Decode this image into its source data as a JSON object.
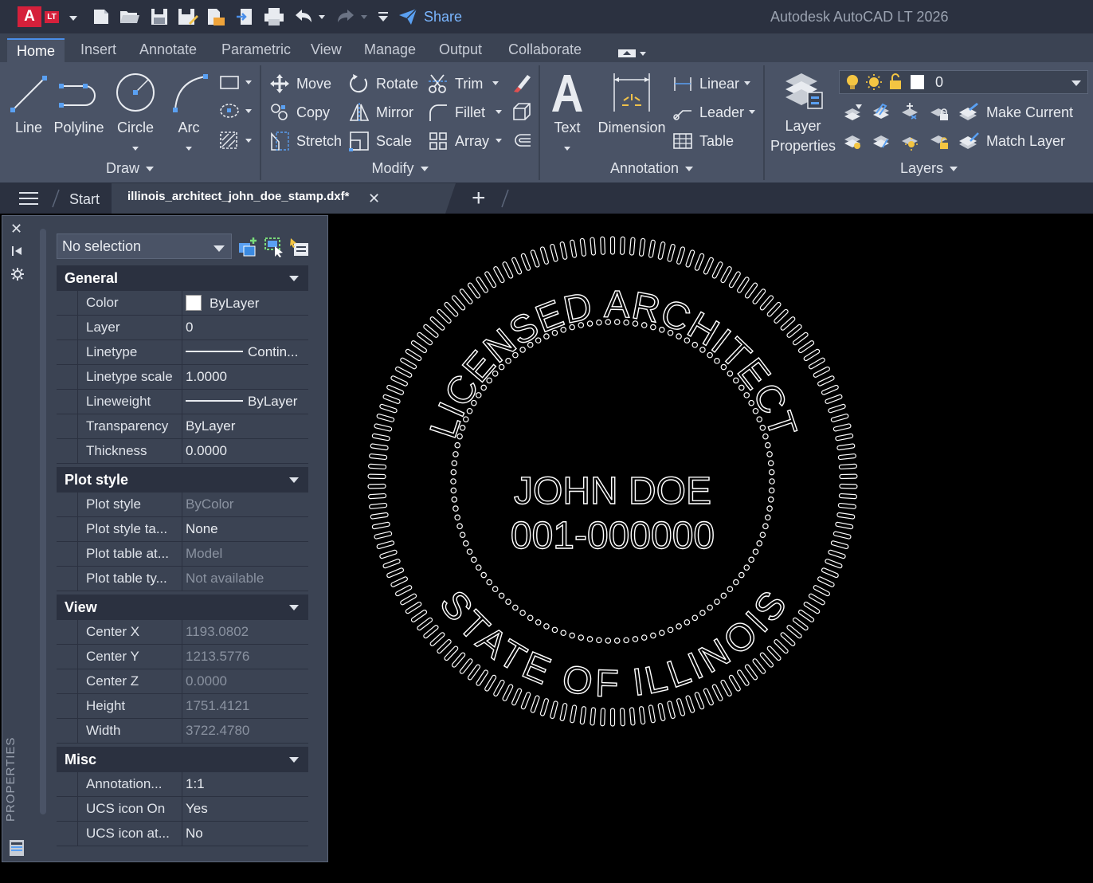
{
  "app": {
    "logo_letter": "A",
    "logo_badge": "LT",
    "window_title": "Autodesk AutoCAD LT 2026",
    "share_label": "Share",
    "accent_color": "#4a8ee8",
    "brand_color": "#d5203b"
  },
  "quick_access": [
    "new-icon",
    "open-icon",
    "save-icon",
    "save-as-icon",
    "open-from-web-icon",
    "save-to-web-icon",
    "plot-icon",
    "undo-icon",
    "redo-icon",
    "customize-icon"
  ],
  "ribbon_tabs": [
    "Home",
    "Insert",
    "Annotate",
    "Parametric",
    "View",
    "Manage",
    "Output",
    "Collaborate"
  ],
  "active_tab": "Home",
  "draw": {
    "title": "Draw",
    "line": "Line",
    "polyline": "Polyline",
    "circle": "Circle",
    "arc": "Arc"
  },
  "modify": {
    "title": "Modify",
    "move": "Move",
    "rotate": "Rotate",
    "trim": "Trim",
    "copy": "Copy",
    "mirror": "Mirror",
    "fillet": "Fillet",
    "stretch": "Stretch",
    "scale": "Scale",
    "array": "Array"
  },
  "annotation": {
    "title": "Annotation",
    "text": "Text",
    "dimension": "Dimension",
    "linear": "Linear",
    "leader": "Leader",
    "table": "Table"
  },
  "layers": {
    "title": "Layers",
    "layer_properties_1": "Layer",
    "layer_properties_2": "Properties",
    "current_layer": "0",
    "make_current": "Make Current",
    "match_layer": "Match Layer"
  },
  "file_tabs": {
    "start": "Start",
    "file": "illinois_architect_john_doe_stamp.dxf*"
  },
  "properties": {
    "strip_title": "PROPERTIES",
    "selection": "No selection",
    "sections": [
      {
        "title": "General",
        "rows": [
          {
            "name": "Color",
            "value": "ByLayer"
          },
          {
            "name": "Layer",
            "value": "0"
          },
          {
            "name": "Linetype",
            "value": "Contin..."
          },
          {
            "name": "Linetype scale",
            "value": "1.0000"
          },
          {
            "name": "Lineweight",
            "value": "ByLayer"
          },
          {
            "name": "Transparency",
            "value": "ByLayer"
          },
          {
            "name": "Thickness",
            "value": "0.0000"
          }
        ]
      },
      {
        "title": "Plot style",
        "rows": [
          {
            "name": "Plot style",
            "value": "ByColor"
          },
          {
            "name": "Plot style ta...",
            "value": "None"
          },
          {
            "name": "Plot table at...",
            "value": "Model"
          },
          {
            "name": "Plot table ty...",
            "value": "Not available"
          }
        ]
      },
      {
        "title": "View",
        "rows": [
          {
            "name": "Center X",
            "value": "1193.0802"
          },
          {
            "name": "Center Y",
            "value": "1213.5776"
          },
          {
            "name": "Center Z",
            "value": "0.0000"
          },
          {
            "name": "Height",
            "value": "1751.4121"
          },
          {
            "name": "Width",
            "value": "3722.4780"
          }
        ]
      },
      {
        "title": "Misc",
        "rows": [
          {
            "name": "Annotation...",
            "value": "1:1"
          },
          {
            "name": "UCS icon On",
            "value": "Yes"
          },
          {
            "name": "UCS icon at...",
            "value": "No"
          }
        ]
      }
    ]
  },
  "stamp": {
    "top_text": "LICENSED ARCHITECT",
    "bottom_text": "STATE OF ILLINOIS",
    "name": "JOHN DOE",
    "license": "001-000000"
  }
}
